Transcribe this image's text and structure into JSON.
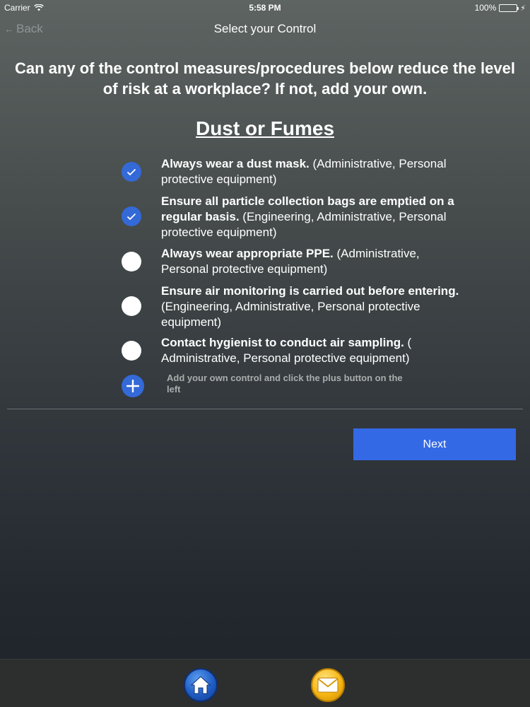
{
  "status_bar": {
    "carrier": "Carrier",
    "time": "5:58 PM",
    "battery": "100%",
    "icons": [
      "wifi-icon",
      "battery-icon",
      "charging-icon"
    ]
  },
  "nav": {
    "back_label": "Back",
    "title": "Select your Control"
  },
  "question": "Can any of the control measures/procedures below reduce the level of risk at a workplace? If not, add your own.",
  "category": "Dust or Fumes",
  "options": [
    {
      "lead": "Always wear a dust mask.",
      "tags": "(Administrative, Personal protective equipment)",
      "checked": true
    },
    {
      "lead": "Ensure all particle collection bags are emptied on a regular basis.",
      "tags": "(Engineering, Administrative, Personal protective equipment)",
      "checked": true
    },
    {
      "lead": "Always wear appropriate PPE.",
      "tags": "(Administrative, Personal protective equipment)",
      "checked": false
    },
    {
      "lead": "Ensure air monitoring is carried out before entering.",
      "tags": "(Engineering, Administrative, Personal protective equipment)",
      "checked": false
    },
    {
      "lead": "Contact hygienist to conduct air sampling.",
      "tags": "( Administrative, Personal protective equipment)",
      "checked": false
    }
  ],
  "add_control": {
    "placeholder": "Add your own control and click the plus button on the left",
    "icon": "plus-icon"
  },
  "next_label": "Next",
  "tab_bar": {
    "icons": [
      "home-icon",
      "mail-icon"
    ]
  },
  "colors": {
    "accent": "#3469d8",
    "next_button": "#3469e6",
    "text": "#ffffff",
    "muted": "#8f9594"
  }
}
